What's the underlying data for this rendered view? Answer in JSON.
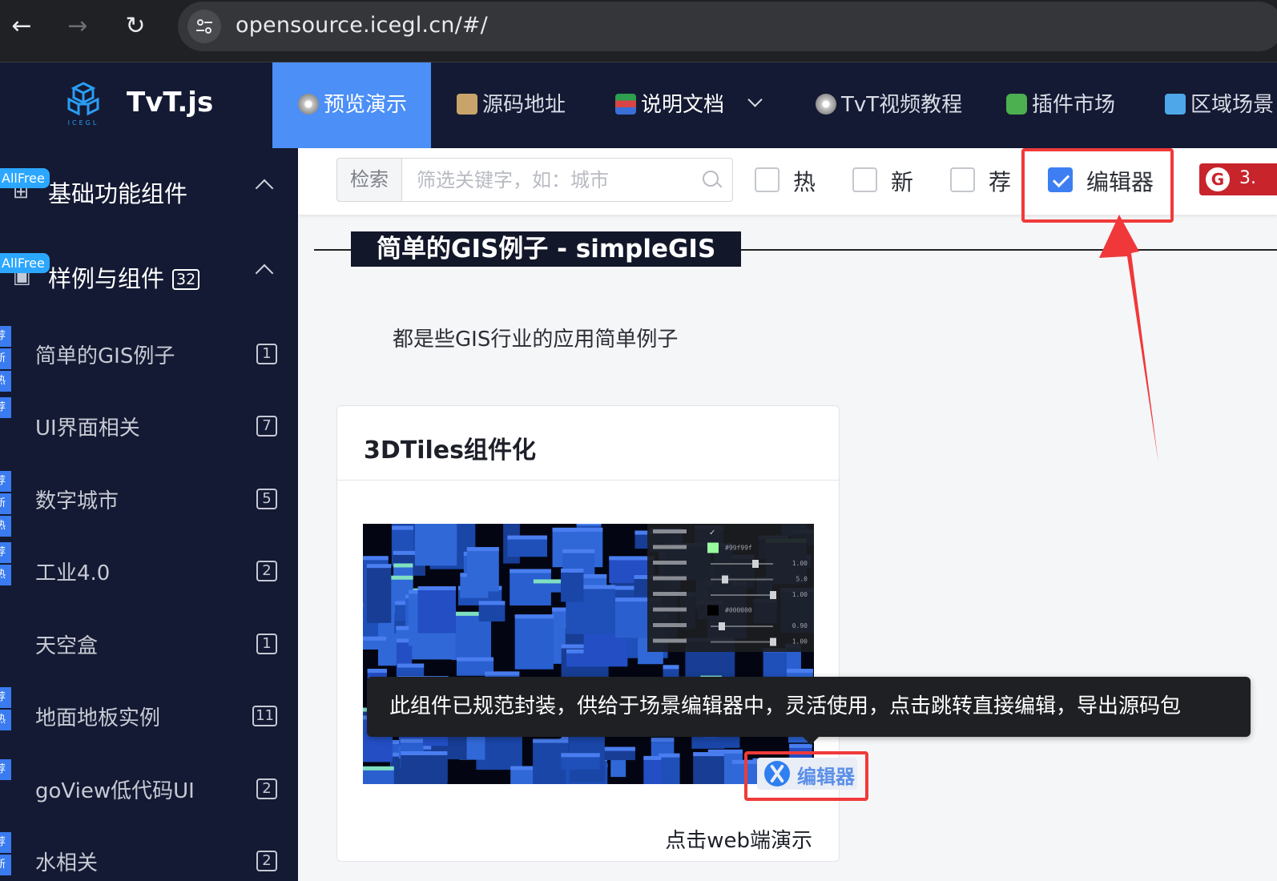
{
  "browser": {
    "url": "opensource.icegl.cn/#/"
  },
  "header": {
    "brand": "TvT.js",
    "logo_text": "ICEGL",
    "nav": [
      {
        "label": "预览演示",
        "icon": "disc-icon",
        "active": true
      },
      {
        "label": "源码地址",
        "icon": "scroll-icon"
      },
      {
        "label": "说明文档",
        "icon": "books-icon",
        "dropdown": true
      },
      {
        "label": "TvT视频教程",
        "icon": "disc-icon"
      },
      {
        "label": "插件市场",
        "icon": "puzzle-icon"
      },
      {
        "label": "区域场景",
        "icon": "free-icon"
      }
    ]
  },
  "sidebar": {
    "groups": [
      {
        "label": "基础功能组件",
        "badge": "AllFree",
        "icon": "grid-icon"
      },
      {
        "label": "样例与组件",
        "badge": "AllFree",
        "count": "32",
        "icon": "picture-icon"
      }
    ],
    "items": [
      {
        "label": "简单的GIS例子",
        "count": "1",
        "tags": [
          "荐",
          "新",
          "热"
        ]
      },
      {
        "label": "UI界面相关",
        "count": "7",
        "tags": [
          "荐"
        ]
      },
      {
        "label": "数字城市",
        "count": "5",
        "tags": [
          "荐",
          "新",
          "热"
        ]
      },
      {
        "label": "工业4.0",
        "count": "2",
        "tags": [
          "荐",
          "热"
        ]
      },
      {
        "label": "天空盒",
        "count": "1",
        "tags": []
      },
      {
        "label": "地面地板实例",
        "count": "11",
        "tags": [
          "荐",
          "热"
        ]
      },
      {
        "label": "goView低代码UI",
        "count": "2",
        "tags": [
          "荐"
        ]
      },
      {
        "label": "水相关",
        "count": "2",
        "tags": [
          "荐",
          "新"
        ]
      }
    ]
  },
  "filter": {
    "search_label": "检索",
    "search_placeholder": "筛选关键字，如：城市",
    "checkboxes": [
      {
        "label": "热",
        "checked": false
      },
      {
        "label": "新",
        "checked": false
      },
      {
        "label": "荐",
        "checked": false
      },
      {
        "label": "编辑器",
        "checked": true
      }
    ],
    "version": "3."
  },
  "main": {
    "section_title": "简单的GIS例子 - simpleGIS",
    "section_desc": "都是些GIS行业的应用简单例子",
    "card": {
      "title": "3DTiles组件化",
      "link": "点击web端演示",
      "editor_label": "编辑器",
      "panel": {
        "color_value": "#99f99f",
        "values": [
          "1.00",
          "5.0",
          "1.00",
          "0.90",
          "1.00"
        ],
        "line_color_value": "#000000"
      }
    },
    "tooltip": "此组件已规范封装，供给于场景编辑器中，灵活使用，点击跳转直接编辑，导出源码包"
  },
  "colors": {
    "header_bg": "#141a33",
    "accent": "#4b8ff7",
    "highlight_red": "#f03a3a"
  }
}
